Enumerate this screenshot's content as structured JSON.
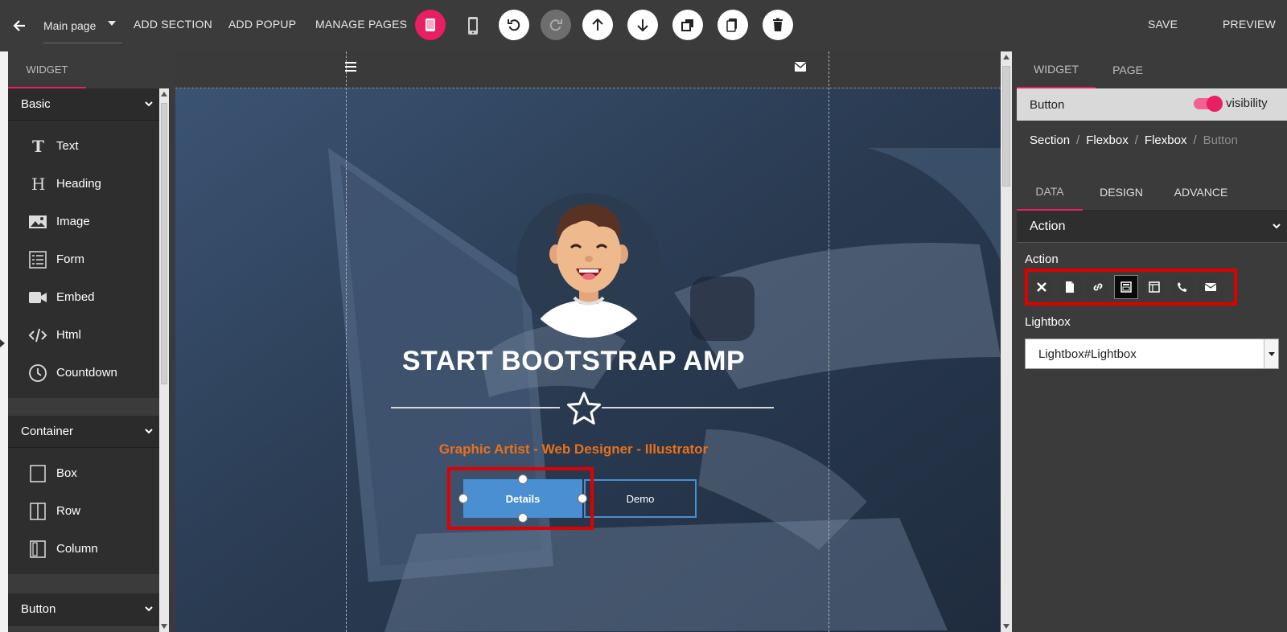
{
  "topbar": {
    "page_select": "Main page",
    "add_section": "ADD SECTION",
    "add_popup": "ADD POPUP",
    "manage_pages": "MANAGE PAGES",
    "save": "SAVE",
    "preview": "PREVIEW"
  },
  "left_panel": {
    "tab": "WIDGET",
    "groups": [
      {
        "title": "Basic",
        "items": [
          "Text",
          "Heading",
          "Image",
          "Form",
          "Embed",
          "Html",
          "Countdown"
        ]
      },
      {
        "title": "Container",
        "items": [
          "Box",
          "Row",
          "Column"
        ]
      },
      {
        "title": "Button",
        "items": []
      }
    ]
  },
  "canvas": {
    "title": "START BOOTSTRAP AMP",
    "subtitle": "Graphic Artist - Web Designer - Illustrator",
    "button_primary": "Details",
    "button_secondary": "Demo"
  },
  "right_panel": {
    "tabs": [
      "WIDGET",
      "PAGE"
    ],
    "element_name": "Button",
    "visibility_label": "visibility",
    "breadcrumb": [
      "Section",
      "Flexbox",
      "Flexbox",
      "Button"
    ],
    "sub_tabs": [
      "DATA",
      "DESIGN",
      "ADVANCE"
    ],
    "accordion": "Action",
    "action_label": "Action",
    "lightbox_label": "Lightbox",
    "lightbox_value": "Lightbox#Lightbox"
  },
  "colors": {
    "accent": "#e91e63",
    "highlight": "#e10000",
    "button_blue": "#4a8fd1",
    "subtitle_orange": "#e8711c"
  }
}
